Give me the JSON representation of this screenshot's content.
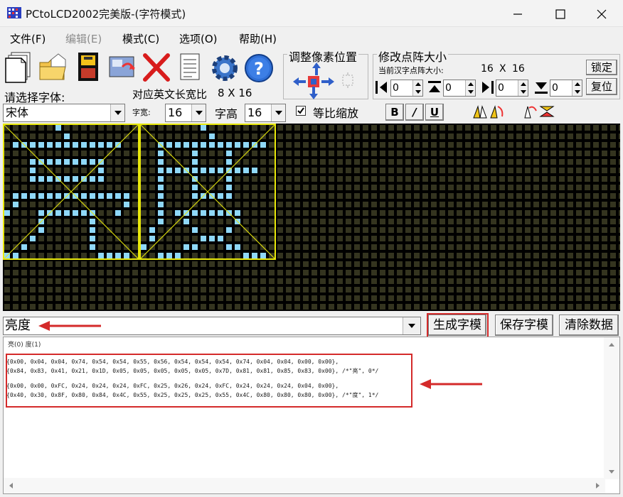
{
  "window": {
    "title": "PCtoLCD2002完美版-(字符模式)",
    "controls": [
      "minimize-icon",
      "maximize-icon",
      "close-icon"
    ]
  },
  "menu": {
    "items": [
      {
        "label": "文件(F)",
        "enabled": true
      },
      {
        "label": "编辑(E)",
        "enabled": false
      },
      {
        "label": "模式(C)",
        "enabled": true
      },
      {
        "label": "选项(O)",
        "enabled": true
      },
      {
        "label": "帮助(H)",
        "enabled": true
      }
    ]
  },
  "toolbar": {
    "icons": [
      "new-file-icon",
      "open-folder-icon",
      "save-disk-icon",
      "import-image-icon",
      "delete-x-icon",
      "notepad-icon",
      "settings-gear-icon",
      "help-icon"
    ]
  },
  "pixel_adjust": {
    "title": "调整像素位置"
  },
  "matrix_size": {
    "title": "修改点阵大小",
    "current_label": "当前汉字点阵大小:",
    "current_w": "16",
    "current_x": "X",
    "current_h": "16",
    "lock_button": "锁定",
    "reset_button": "复位",
    "spin_values": [
      "0",
      "0",
      "0",
      "0"
    ]
  },
  "font": {
    "select_label": "请选择字体:",
    "font_value": "宋体",
    "ratio_label": "对应英文长宽比",
    "ratio_value": "8 X 16",
    "width_label": "字宽:",
    "width_value": "16",
    "height_label": "字高",
    "height_value": "16",
    "proportional_label": "等比缩放",
    "proportional_checked": true,
    "bold": "B",
    "italic": "/",
    "underline": "U"
  },
  "input": {
    "text": "亮度",
    "generate_button": "生成字模",
    "save_button": "保存字模",
    "clear_button": "清除数据"
  },
  "output": {
    "tags": "亮(0) 度(1)",
    "lines": [
      "{0x00, 0x04, 0x04, 0x74, 0x54, 0x54, 0x55, 0x56, 0x54, 0x54, 0x54, 0x74, 0x04, 0x04, 0x00, 0x00},",
      "{0x84, 0x83, 0x41, 0x21, 0x1D, 0x05, 0x05, 0x05, 0x05, 0x05, 0x7D, 0x81, 0x81, 0x85, 0x83, 0x00}, /*\"亮\", 0*/",
      "",
      "{0x00, 0x00, 0xFC, 0x24, 0x24, 0x24, 0xFC, 0x25, 0x26, 0x24, 0xFC, 0x24, 0x24, 0x24, 0x04, 0x00},",
      "{0x40, 0x30, 0x8F, 0x80, 0x84, 0x4C, 0x55, 0x25, 0x25, 0x25, 0x55, 0x4C, 0x80, 0x80, 0x80, 0x00}, /*\"度\", 1*/"
    ]
  },
  "colors": {
    "matrix_bg": "#000000",
    "dot_off": "#34341f",
    "dot_on": "#8fd8f8",
    "frame": "#e8e80a",
    "annotation": "#d42a2a"
  }
}
